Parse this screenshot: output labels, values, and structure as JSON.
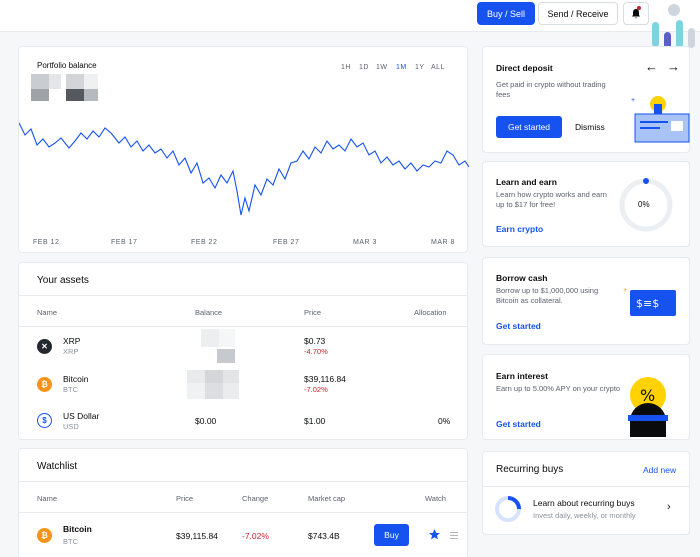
{
  "topbar": {
    "buy_sell": "Buy / Sell",
    "send_receive": "Send / Receive",
    "bell_icon": "bell-icon",
    "notification_color": "#cf202f"
  },
  "portfolio": {
    "title": "Portfolio balance",
    "ranges": [
      "1H",
      "1D",
      "1W",
      "1M",
      "1Y",
      "ALL"
    ],
    "active_range": "1M",
    "dates": [
      "FEB 12",
      "FEB 17",
      "FEB 22",
      "FEB 27",
      "MAR 3",
      "MAR 8"
    ]
  },
  "assets": {
    "title": "Your assets",
    "headers": [
      "Name",
      "Balance",
      "Price",
      "Allocation"
    ],
    "rows": [
      {
        "name": "XRP",
        "symbol": "XRP",
        "balance": "",
        "price": "$0.73",
        "change": "-4.70%",
        "allocation": "",
        "icon": "xrp-icon",
        "color": "#23292f"
      },
      {
        "name": "Bitcoin",
        "symbol": "BTC",
        "balance": "",
        "price": "$39,116.84",
        "change": "-7.02%",
        "allocation": "",
        "icon": "bitcoin-icon",
        "color": "#f7931a"
      },
      {
        "name": "US Dollar",
        "symbol": "USD",
        "balance": "$0.00",
        "price": "$1.00",
        "change": "",
        "allocation": "0%",
        "icon": "usd-icon",
        "color": "#1652f0"
      }
    ]
  },
  "watchlist": {
    "title": "Watchlist",
    "headers": [
      "Name",
      "Price",
      "Change",
      "Market cap",
      "Watch"
    ],
    "rows": [
      {
        "name": "Bitcoin",
        "symbol": "BTC",
        "price": "$39,115.84",
        "change": "-7.02%",
        "market_cap": "$743.4B",
        "buy": "Buy",
        "icon": "bitcoin-icon",
        "starred": true
      }
    ]
  },
  "direct_deposit": {
    "title": "Direct deposit",
    "desc": "Get paid in crypto without trading fees",
    "cta": "Get started",
    "dismiss": "Dismiss"
  },
  "learn_earn": {
    "title": "Learn and earn",
    "desc": "Learn how crypto works and earn up to $17 for free!",
    "link": "Earn crypto",
    "progress": "0%",
    "progress_value": 0
  },
  "borrow": {
    "title": "Borrow cash",
    "desc": "Borrow up to $1,000,000 using Bitcoin as collateral.",
    "link": "Get started"
  },
  "interest": {
    "title": "Earn interest",
    "desc": "Earn up to 5.00% APY on your crypto",
    "link": "Get started",
    "icon_symbol": "%"
  },
  "recurring": {
    "title": "Recurring buys",
    "add": "Add new",
    "item_title": "Learn about recurring buys",
    "item_desc": "Invest daily, weekly, or monthly"
  },
  "colors": {
    "accent": "#1652f0",
    "negative": "#cf202f"
  }
}
